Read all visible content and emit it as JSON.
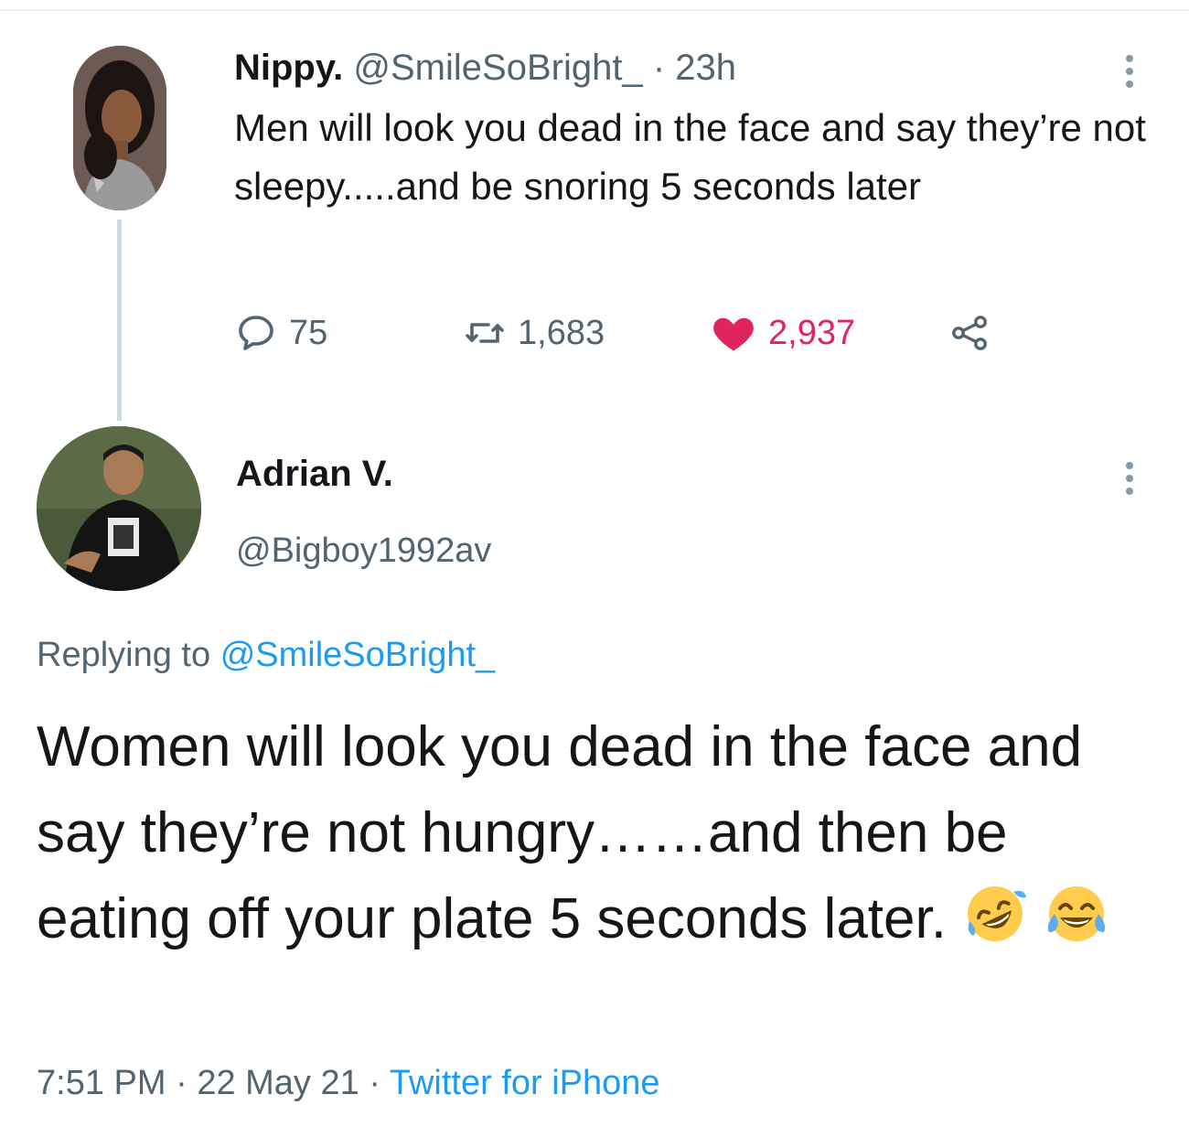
{
  "parent_tweet": {
    "name": "Nippy.",
    "handle": "@SmileSoBright_",
    "separator": "·",
    "time": "23h",
    "text": "Men will look you dead in the face and say they’re not sleepy.....and be snoring 5 seconds later",
    "stats": {
      "replies": "75",
      "retweets": "1,683",
      "likes": "2,937"
    },
    "icons": [
      "reply-icon",
      "retweet-icon",
      "heart-icon",
      "share-icon",
      "more-icon"
    ],
    "like_color": "#e0245e"
  },
  "reply_tweet": {
    "name": "Adrian V.",
    "handle": "@Bigboy1992av",
    "replying_prefix": "Replying to",
    "replying_handle": "@SmileSoBright_",
    "text": "Women will look you dead in the face and say they’re not hungry……and then be eating off your plate 5 seconds later.",
    "emojis": [
      "rolling-on-floor-laughing-emoji",
      "tears-of-joy-emoji"
    ],
    "time": "7:51 PM",
    "date": "22 May 21",
    "source": "Twitter for iPhone",
    "separator": "·"
  },
  "colors": {
    "link": "#1d9bf0",
    "muted": "#536471",
    "text": "#14171a"
  }
}
